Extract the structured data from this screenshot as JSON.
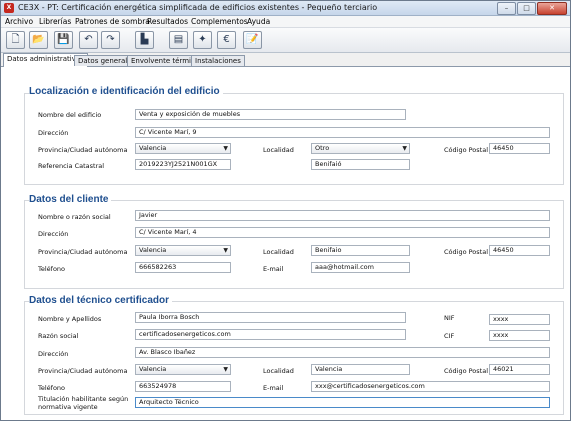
{
  "window": {
    "title": "CE3X - PT: Certificación energética simplificada de edificios existentes - Pequeño terciario",
    "app_icon": "X",
    "buttons": {
      "minimize": "–",
      "maximize": "□",
      "close": "✕"
    }
  },
  "menu": [
    "Archivo",
    "Librerías",
    "Patrones de sombra",
    "Resultados",
    "Complementos",
    "Ayuda"
  ],
  "toolbar": {
    "icons": [
      "new-document-icon",
      "open-folder-icon",
      "save-icon",
      "undo-icon",
      "redo-icon",
      "building-icon",
      "stats-icon",
      "wand-icon",
      "euro-icon",
      "notes-icon"
    ],
    "glyphs": [
      "🗋",
      "📂",
      "💾",
      "↶",
      "↷",
      "▙",
      "▤",
      "✦",
      "€",
      "📝"
    ]
  },
  "tabs": [
    "Datos administrativos",
    "Datos generales",
    "Envolvente térmica",
    "Instalaciones"
  ],
  "sections": {
    "location": {
      "title": "Localización e identificación del edificio",
      "labels": {
        "building_name": "Nombre del edificio",
        "address": "Dirección",
        "province": "Provincia/Ciudad autónoma",
        "locality": "Localidad",
        "postal_code": "Código Postal",
        "cadastral_ref": "Referencia Catastral"
      },
      "values": {
        "building_name": "Venta y exposición de muebles",
        "address": "C/ Vicente Marí, 9",
        "province": "Valencia",
        "locality": "Otro",
        "postal_code": "46450",
        "cadastral_ref": "2019223YJ2521N001GX",
        "locality_other": "Benifaió"
      }
    },
    "client": {
      "title": "Datos del cliente",
      "labels": {
        "name": "Nombre o razón social",
        "address": "Dirección",
        "province": "Provincia/Ciudad autónoma",
        "locality": "Localidad",
        "postal_code": "Código Postal",
        "phone": "Teléfono",
        "email": "E-mail"
      },
      "values": {
        "name": "Javier",
        "address": "C/ Vicente Marí, 4",
        "province": "Valencia",
        "locality": "Benifaio",
        "postal_code": "46450",
        "phone": "666582263",
        "email": "aaa@hotmail.com"
      }
    },
    "technician": {
      "title": "Datos del técnico certificador",
      "labels": {
        "name": "Nombre y Apellidos",
        "nif": "NIF",
        "company": "Razón social",
        "cif": "CIF",
        "address": "Dirección",
        "province": "Provincia/Ciudad autónoma",
        "locality": "Localidad",
        "postal_code": "Código Postal",
        "phone": "Teléfono",
        "email": "E-mail",
        "qualification_line1": "Titulación habilitante según",
        "qualification_line2": "normativa vigente"
      },
      "values": {
        "name": "Paula Iborra Bosch",
        "nif": "xxxx",
        "company": "certificadosenergeticos.com",
        "cif": "xxxx",
        "address": "Av. Blasco Ibañez",
        "province": "Valencia",
        "locality": "Valencia",
        "postal_code": "46021",
        "phone": "663524978",
        "email": "xxx@certificadosenergeticos.com",
        "qualification": "Arquitecto Técnico"
      }
    }
  },
  "dropdown_arrow": "▼"
}
